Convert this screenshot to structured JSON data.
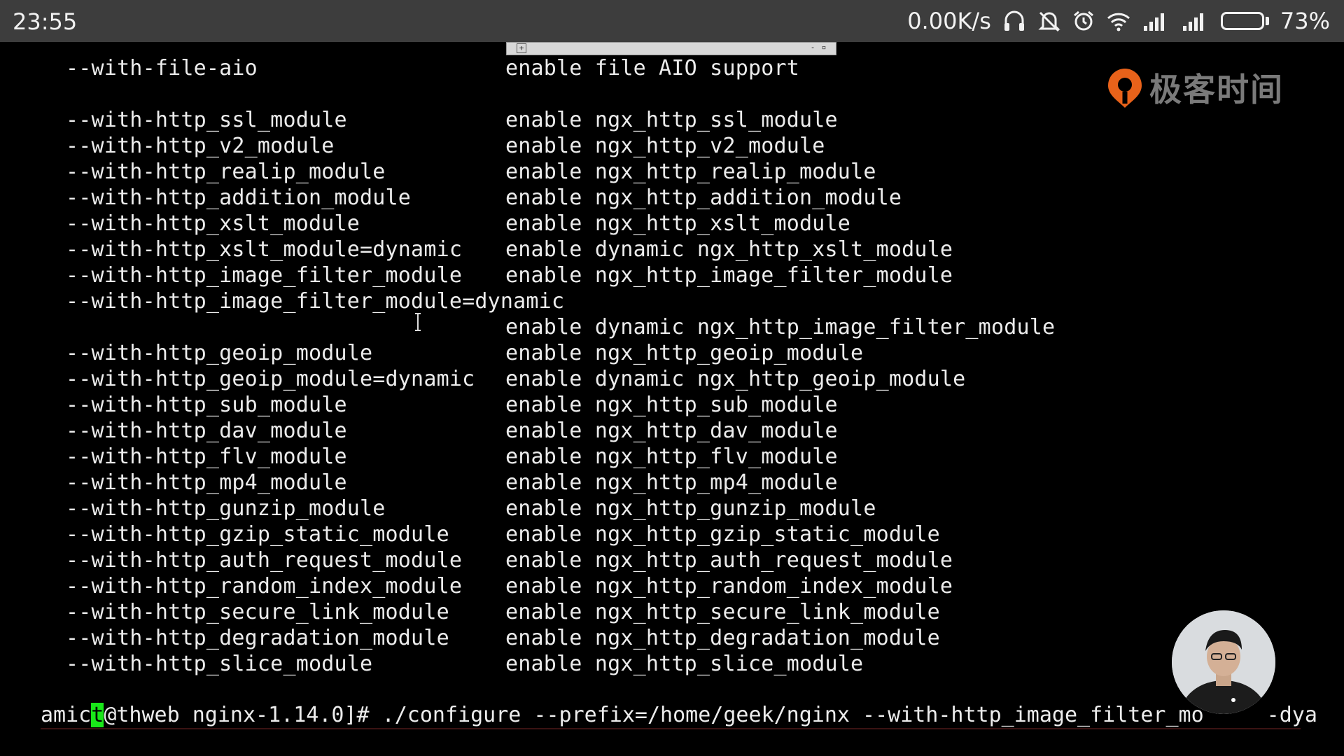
{
  "status_bar": {
    "time": "23:55",
    "net_speed": "0.00K/s",
    "battery_percent": "73%",
    "battery_level": 0.73,
    "icons": [
      "headset-icon",
      "mute-icon",
      "alarm-icon",
      "wifi-icon",
      "signal-icon",
      "signal-icon",
      "battery-icon"
    ]
  },
  "logo": {
    "text": "极客时间"
  },
  "terminal": {
    "lines": [
      {
        "opt": "--with-file-aio",
        "desc": "enable file AIO support"
      },
      {
        "opt": "--with-http_ssl_module",
        "desc": "enable ngx_http_ssl_module"
      },
      {
        "opt": "--with-http_v2_module",
        "desc": "enable ngx_http_v2_module"
      },
      {
        "opt": "--with-http_realip_module",
        "desc": "enable ngx_http_realip_module"
      },
      {
        "opt": "--with-http_addition_module",
        "desc": "enable ngx_http_addition_module"
      },
      {
        "opt": "--with-http_xslt_module",
        "desc": "enable ngx_http_xslt_module"
      },
      {
        "opt": "--with-http_xslt_module=dynamic",
        "desc": "enable dynamic ngx_http_xslt_module"
      },
      {
        "opt": "--with-http_image_filter_module",
        "desc": "enable ngx_http_image_filter_module"
      },
      {
        "opt": "--with-http_image_filter_module=dynamic",
        "desc": ""
      },
      {
        "opt": "",
        "desc": "enable dynamic ngx_http_image_filter_module"
      },
      {
        "opt": "--with-http_geoip_module",
        "desc": "enable ngx_http_geoip_module"
      },
      {
        "opt": "--with-http_geoip_module=dynamic",
        "desc": "enable dynamic ngx_http_geoip_module"
      },
      {
        "opt": "--with-http_sub_module",
        "desc": "enable ngx_http_sub_module"
      },
      {
        "opt": "--with-http_dav_module",
        "desc": "enable ngx_http_dav_module"
      },
      {
        "opt": "--with-http_flv_module",
        "desc": "enable ngx_http_flv_module"
      },
      {
        "opt": "--with-http_mp4_module",
        "desc": "enable ngx_http_mp4_module"
      },
      {
        "opt": "--with-http_gunzip_module",
        "desc": "enable ngx_http_gunzip_module"
      },
      {
        "opt": "--with-http_gzip_static_module",
        "desc": "enable ngx_http_gzip_static_module"
      },
      {
        "opt": "--with-http_auth_request_module",
        "desc": "enable ngx_http_auth_request_module"
      },
      {
        "opt": "--with-http_random_index_module",
        "desc": "enable ngx_http_random_index_module"
      },
      {
        "opt": "--with-http_secure_link_module",
        "desc": "enable ngx_http_secure_link_module"
      },
      {
        "opt": "--with-http_degradation_module",
        "desc": "enable ngx_http_degradation_module"
      },
      {
        "opt": "--with-http_slice_module",
        "desc": "enable ngx_http_slice_module"
      }
    ],
    "prompt": {
      "before_cursor": "amic",
      "cursor_char": "t",
      "after_cursor": "@thweb nginx-1.14.0]# ./configure --prefix=/home/geek/nginx --with-http_image_filter_mo",
      "tail": "-dya"
    }
  }
}
